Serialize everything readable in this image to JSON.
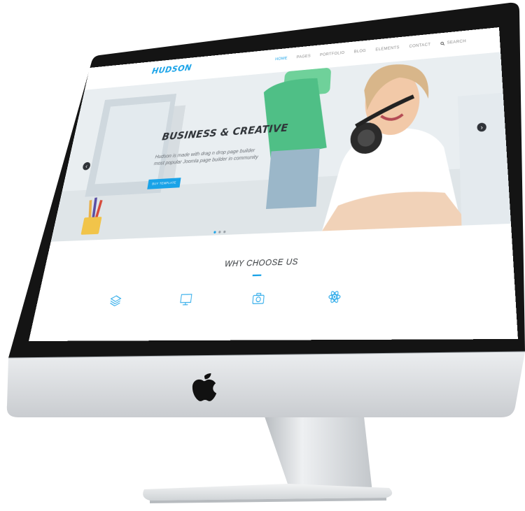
{
  "site": {
    "logo": "HUDSON",
    "nav": [
      "HOME",
      "PAGES",
      "PORTFOLIO",
      "BLOG",
      "ELEMENTS",
      "CONTACT"
    ],
    "search_label": "SEARCH",
    "active_nav": "HOME"
  },
  "hero": {
    "title": "BUSINESS & CREATIVE",
    "line1": "Hudson is made with drag n drop page builder",
    "line2": "most popular Joomla page builder in community",
    "button": "BUY TEMPLATE",
    "prev_glyph": "‹",
    "next_glyph": "›"
  },
  "section": {
    "heading": "WHY CHOOSE US",
    "icons": [
      "layers-icon",
      "monitor-icon",
      "camera-icon",
      "atom-icon"
    ]
  },
  "colors": {
    "accent": "#1aa3e8",
    "bezel": "#1b1b1b",
    "chin": "#d9dcdf"
  }
}
